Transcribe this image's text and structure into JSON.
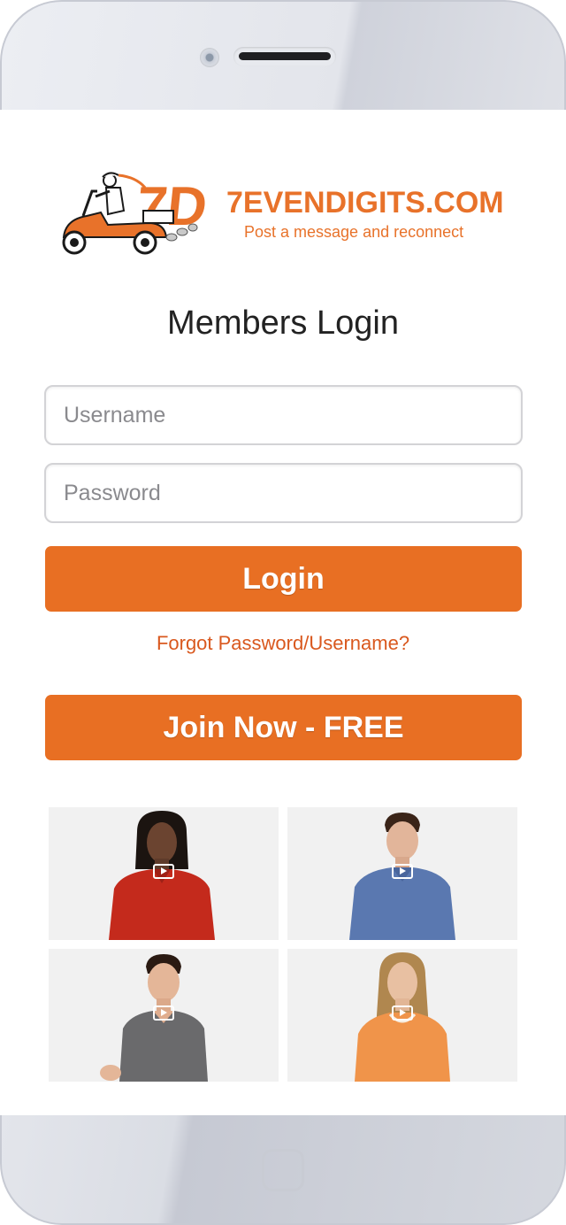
{
  "brand": {
    "logo_mark": "7D",
    "name": "7EVENDIGITS.COM",
    "tagline": "Post a message and reconnect",
    "accent_color": "#e8722a"
  },
  "login": {
    "title": "Members Login",
    "username_placeholder": "Username",
    "password_placeholder": "Password",
    "login_label": "Login",
    "forgot_label": "Forgot Password/Username?",
    "join_label": "Join Now - FREE"
  },
  "videos": [
    {
      "person": "woman in red shirt",
      "icon": "play-icon"
    },
    {
      "person": "man in blue shirt",
      "icon": "play-icon"
    },
    {
      "person": "young man in gray t-shirt",
      "icon": "play-icon"
    },
    {
      "person": "woman in orange top",
      "icon": "play-icon"
    }
  ],
  "colors": {
    "button": "#e86f23",
    "link": "#d9581e",
    "title": "#222222"
  }
}
